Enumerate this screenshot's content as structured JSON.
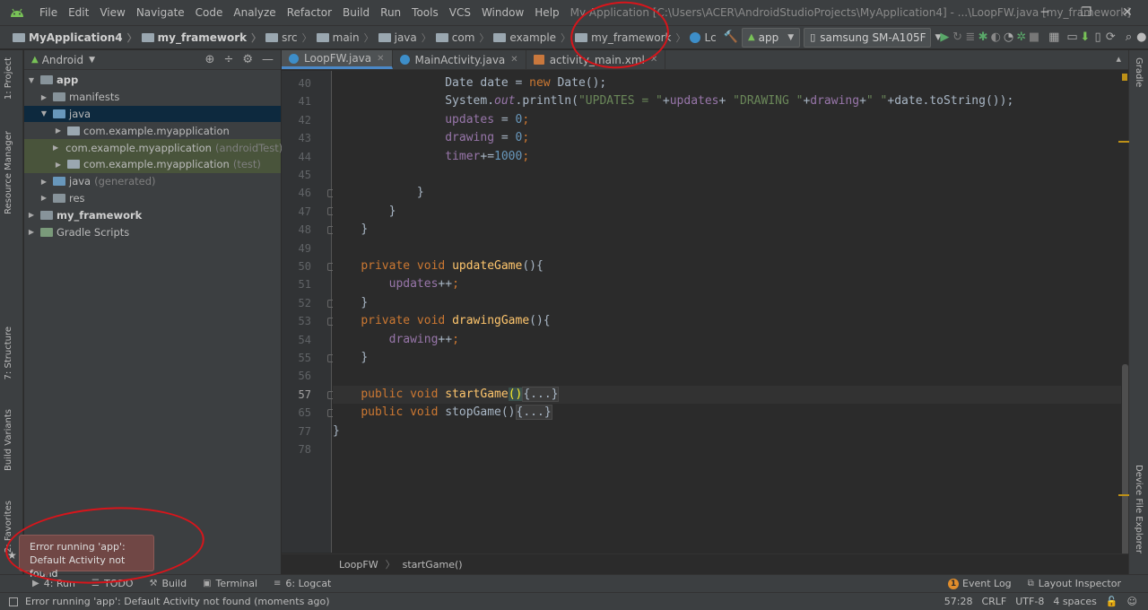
{
  "window": {
    "title": "My Application [C:\\Users\\ACER\\AndroidStudioProjects\\MyApplication4] - ...\\LoopFW.java [my_framework]",
    "controls": [
      "─",
      "❐",
      "✕"
    ]
  },
  "menu": [
    "File",
    "Edit",
    "View",
    "Navigate",
    "Code",
    "Analyze",
    "Refactor",
    "Build",
    "Run",
    "Tools",
    "VCS",
    "Window",
    "Help"
  ],
  "navbar": {
    "crumbs": [
      "MyApplication4",
      "my_framework",
      "src",
      "main",
      "java",
      "com",
      "example",
      "my_framework",
      "Lc"
    ],
    "run_config": "app",
    "device": "samsung SM-A105F"
  },
  "left_tool_tabs": [
    "1: Project",
    "Resource Manager",
    "7: Structure",
    "Build Variants",
    "2: Favorites"
  ],
  "right_tool_tabs": [
    "Gradle",
    "Device File Explorer"
  ],
  "project_panel": {
    "view": "Android",
    "tree": [
      {
        "label": "app",
        "suffix": "",
        "depth": 0,
        "expanded": true,
        "bold": true
      },
      {
        "label": "manifests",
        "suffix": "",
        "depth": 1,
        "expanded": false
      },
      {
        "label": "java",
        "suffix": "",
        "depth": 1,
        "expanded": true,
        "selected": true
      },
      {
        "label": "com.example.myapplication",
        "suffix": "",
        "depth": 2,
        "expanded": false
      },
      {
        "label": "com.example.myapplication",
        "suffix": "(androidTest)",
        "depth": 2,
        "expanded": false,
        "green": true
      },
      {
        "label": "com.example.myapplication",
        "suffix": "(test)",
        "depth": 2,
        "expanded": false,
        "green": true
      },
      {
        "label": "java",
        "suffix": "(generated)",
        "depth": 1,
        "expanded": false
      },
      {
        "label": "res",
        "suffix": "",
        "depth": 1,
        "expanded": false
      },
      {
        "label": "my_framework",
        "suffix": "",
        "depth": 0,
        "expanded": false,
        "bold": true
      },
      {
        "label": "Gradle Scripts",
        "suffix": "",
        "depth": 0,
        "expanded": false
      }
    ]
  },
  "editor": {
    "tabs": [
      {
        "label": "LoopFW.java",
        "active": true,
        "type": "class"
      },
      {
        "label": "MainActivity.java",
        "active": false,
        "type": "class"
      },
      {
        "label": "activity_main.xml",
        "active": false,
        "type": "xml"
      }
    ],
    "line_numbers": [
      "40",
      "41",
      "42",
      "43",
      "44",
      "45",
      "46",
      "47",
      "48",
      "49",
      "50",
      "51",
      "52",
      "53",
      "54",
      "55",
      "56",
      "57",
      "65",
      "77",
      "78"
    ],
    "current_line": "57",
    "breadcrumb": [
      "LoopFW",
      "startGame()"
    ]
  },
  "bottom_tools": [
    "4: Run",
    "TODO",
    "Build",
    "Terminal",
    "6: Logcat"
  ],
  "bottom_right_tools": [
    "Event Log",
    "Layout Inspector"
  ],
  "status": {
    "message": "Error running 'app': Default Activity not found (moments ago)",
    "position": "57:28",
    "line_sep": "CRLF",
    "encoding": "UTF-8",
    "indent": "4 spaces"
  },
  "balloon": {
    "line1": "Error running 'app':",
    "line2": "Default Activity not found"
  },
  "colors": {
    "keyword": "#cc7832",
    "method": "#ffc66d",
    "field": "#9876aa",
    "string": "#6a8759",
    "number": "#6897bb",
    "annotation": "#d8151b",
    "error_balloon": "#704745"
  }
}
